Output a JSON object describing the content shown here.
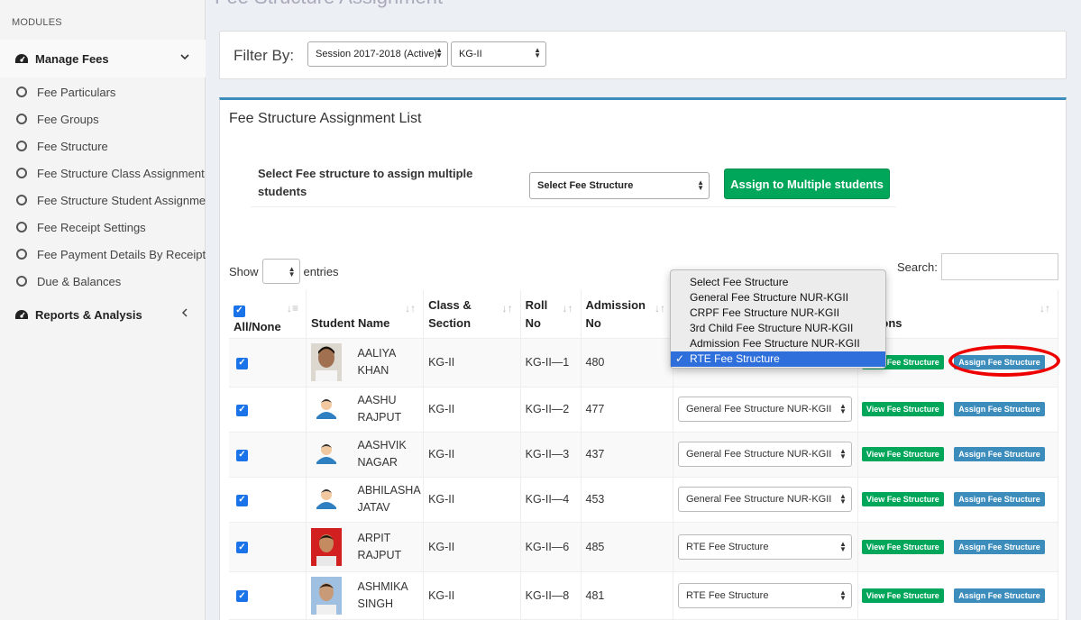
{
  "sidebar": {
    "modules_label": "MODULES",
    "manage_fees": "Manage Fees",
    "items": [
      {
        "label": "Fee Particulars"
      },
      {
        "label": "Fee Groups"
      },
      {
        "label": "Fee Structure"
      },
      {
        "label": "Fee Structure Class Assignment"
      },
      {
        "label": "Fee Structure Student Assignment"
      },
      {
        "label": "Fee Receipt Settings"
      },
      {
        "label": "Fee Payment Details By Receipt No"
      },
      {
        "label": "Due & Balances"
      }
    ],
    "reports": "Reports & Analysis"
  },
  "page_title": "Fee Structure Assignment",
  "filter": {
    "label": "Filter By:",
    "session": "Session 2017-2018 (Active)",
    "class": "KG-II"
  },
  "list": {
    "title": "Fee Structure Assignment List",
    "assign_label": "Select Fee structure to assign multiple students",
    "select_placeholder": "Select Fee Structure",
    "assign_button": "Assign to Multiple students",
    "show_label": "Show",
    "entries_label": "entries",
    "search_label": "Search:"
  },
  "table": {
    "headers": {
      "all_none": "All/None",
      "student_name": "Student Name",
      "class_section": "Class & Section",
      "roll_no": "Roll No",
      "admission_no": "Admission No",
      "actions": "Actions"
    },
    "view_btn": "View Fee Structure",
    "assign_btn": "Assign Fee Structure",
    "rows": [
      {
        "name1": "AALIYA",
        "name2": "KHAN",
        "class": "KG-II",
        "roll": "KG-II—1",
        "adm": "480",
        "fee": "RTE Fee Structure"
      },
      {
        "name1": "AASHU",
        "name2": "RAJPUT",
        "class": "KG-II",
        "roll": "KG-II—2",
        "adm": "477",
        "fee": "General Fee Structure NUR-KGII"
      },
      {
        "name1": "AASHVIK",
        "name2": "NAGAR",
        "class": "KG-II",
        "roll": "KG-II—3",
        "adm": "437",
        "fee": "General Fee Structure NUR-KGII"
      },
      {
        "name1": "ABHILASHA",
        "name2": "JATAV",
        "class": "KG-II",
        "roll": "KG-II—4",
        "adm": "453",
        "fee": "General Fee Structure NUR-KGII"
      },
      {
        "name1": "ARPIT",
        "name2": "RAJPUT",
        "class": "KG-II",
        "roll": "KG-II—6",
        "adm": "485",
        "fee": "RTE Fee Structure"
      },
      {
        "name1": "ASHMIKA",
        "name2": "SINGH",
        "class": "KG-II",
        "roll": "KG-II—8",
        "adm": "481",
        "fee": "RTE Fee Structure"
      }
    ]
  },
  "dropdown": {
    "options": [
      "Select Fee Structure",
      "General Fee Structure NUR-KGII",
      "CRPF Fee Structure NUR-KGII",
      "3rd Child Fee Structure NUR-KGII",
      "Admission Fee Structure NUR-KGII",
      "RTE Fee Structure"
    ],
    "selected_index": 5
  },
  "colors": {
    "accent": "#3c8dbc",
    "success": "#00a65a",
    "highlight": "#e00000"
  }
}
